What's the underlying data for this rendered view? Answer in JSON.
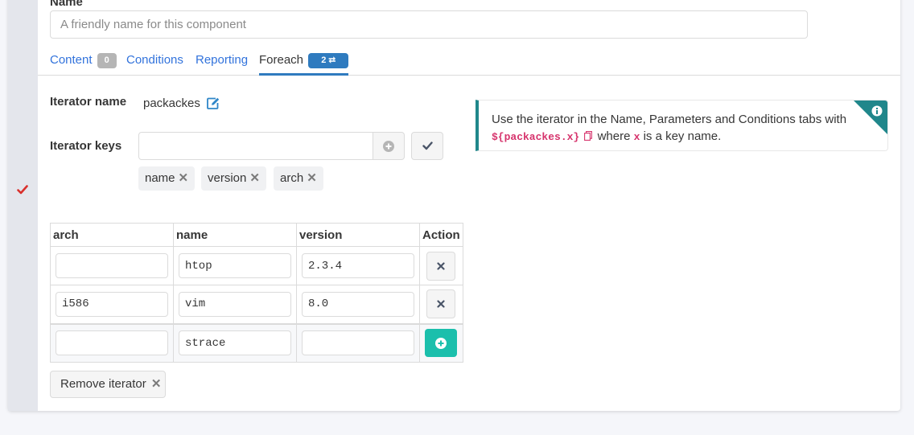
{
  "name_field": {
    "label": "Name",
    "placeholder": "A friendly name for this component",
    "value": ""
  },
  "tabs": [
    {
      "label": "Content",
      "badge": "0"
    },
    {
      "label": "Conditions"
    },
    {
      "label": "Reporting"
    },
    {
      "label": "Foreach",
      "badge": "2 ⮂",
      "active": true
    }
  ],
  "iterator": {
    "name_label": "Iterator name",
    "name_value": "packackes",
    "keys_label": "Iterator keys",
    "keys_input_value": "",
    "keys": [
      "name",
      "version",
      "arch"
    ]
  },
  "info": {
    "text_before": "Use the iterator in the Name, Parameters and Conditions tabs with",
    "code": "${packackes.x}",
    "text_middle": "where",
    "code_key": "x",
    "text_after": "is a key name."
  },
  "table": {
    "headers": [
      "arch",
      "name",
      "version",
      "Action"
    ],
    "rows": [
      {
        "arch": "",
        "name": "htop",
        "version": "2.3.4"
      },
      {
        "arch": "i586",
        "name": "vim",
        "version": "8.0"
      }
    ],
    "new_row": {
      "arch": "",
      "name": "strace",
      "version": ""
    }
  },
  "remove_button": {
    "label": "Remove iterator",
    "icon": "times-icon"
  },
  "colors": {
    "accent": "#2f7bbf",
    "teal": "#20878b",
    "success": "#1bbfac",
    "check": "#d9302c"
  }
}
